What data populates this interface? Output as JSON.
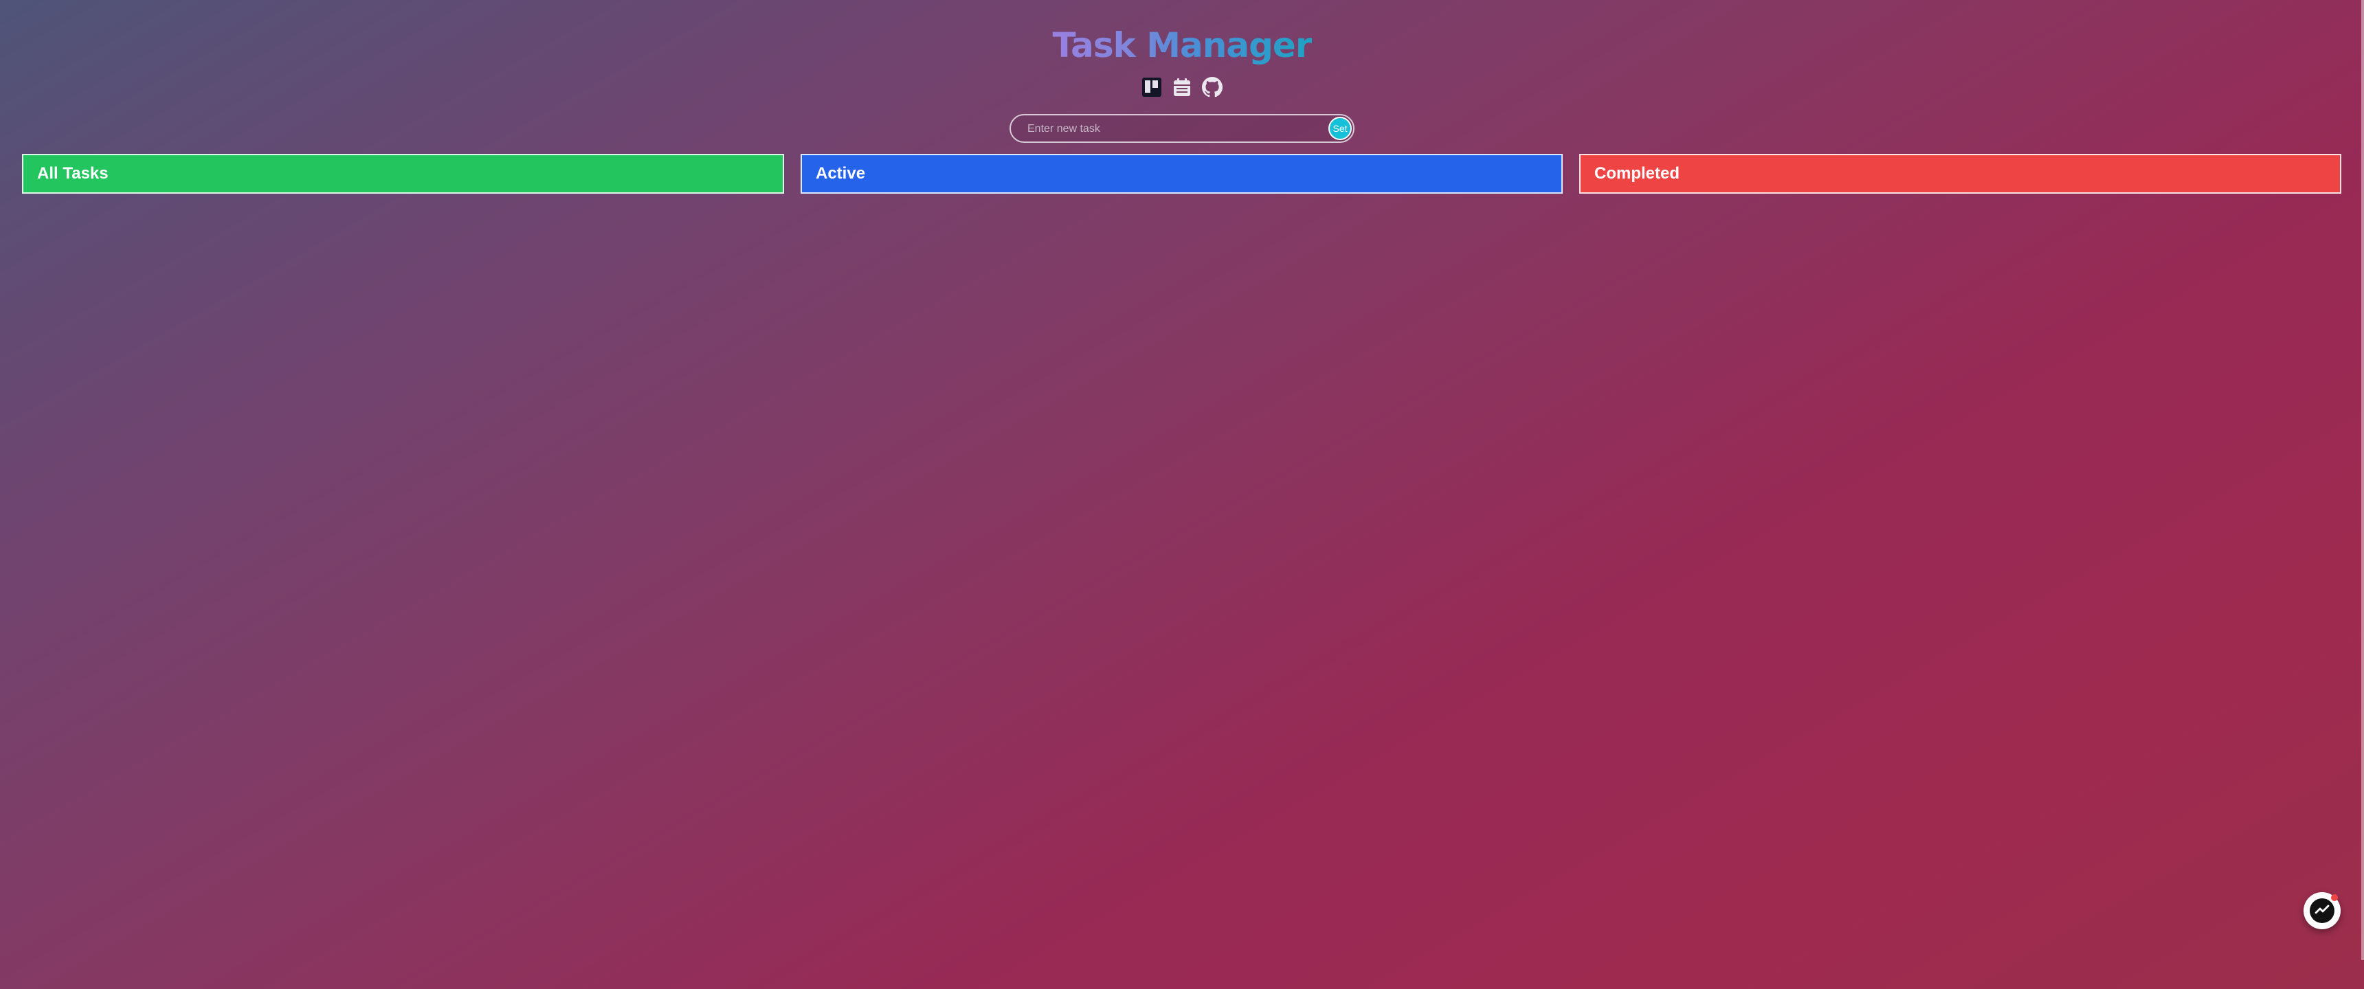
{
  "header": {
    "title": "Task Manager",
    "icons": [
      "kanban-board-icon",
      "calendar-icon",
      "github-icon"
    ]
  },
  "task_form": {
    "placeholder": "Enter new task",
    "value": "",
    "submit_label": "Set"
  },
  "columns": [
    {
      "label": "All Tasks",
      "color": "#22c55e"
    },
    {
      "label": "Active",
      "color": "#2563eb"
    },
    {
      "label": "Completed",
      "color": "#ef4444"
    }
  ],
  "chat_widget": {
    "icon": "messenger-icon",
    "has_notification": true
  },
  "colors": {
    "title_gradient": [
      "#9b80e0",
      "#1ea3c4"
    ],
    "set_button": "#15c0d8"
  }
}
